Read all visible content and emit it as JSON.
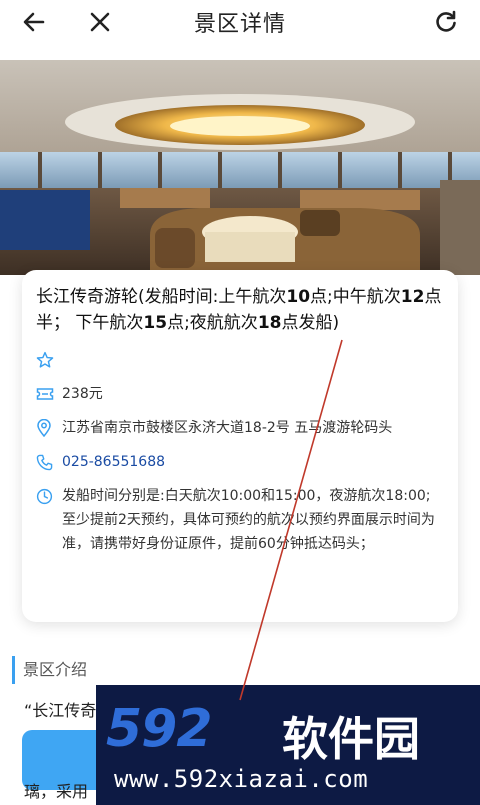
{
  "header": {
    "title": "景区详情"
  },
  "card": {
    "name_parts": [
      {
        "t": "长江传奇游轮(发船时间:上午航次",
        "b": false
      },
      {
        "t": "10",
        "b": true
      },
      {
        "t": "点;中午航次",
        "b": false
      },
      {
        "t": "12",
        "b": true
      },
      {
        "t": "点半； 下午航次",
        "b": false
      },
      {
        "t": "15",
        "b": true
      },
      {
        "t": "点;夜航航次",
        "b": false
      },
      {
        "t": "18",
        "b": true
      },
      {
        "t": "点发船)",
        "b": false
      }
    ],
    "price": "238元",
    "address": "江苏省南京市鼓楼区永济大道18-2号 五马渡游轮码头",
    "phone": "025-86551688",
    "hours": "发船时间分别是:白天航次10:00和15:00，夜游航次18:00;至少提前2天预约，具体可预约的航次以预约界面展示时间为准，请携带好身份证原件，提前60分钟抵达码头；"
  },
  "section": {
    "title": "景区介绍",
    "text": "“长江传奇",
    "text2": "璃，采用"
  },
  "watermark": {
    "digits": "592",
    "cn": "软件园",
    "url": "www.592xiazai.com"
  },
  "colors": {
    "accent": "#3aa0f0",
    "phone": "#1a4ba3",
    "icon": "#3aa0f0",
    "watermark_bg": "#0d1a44",
    "watermark_blue": "#2f6dd8"
  }
}
